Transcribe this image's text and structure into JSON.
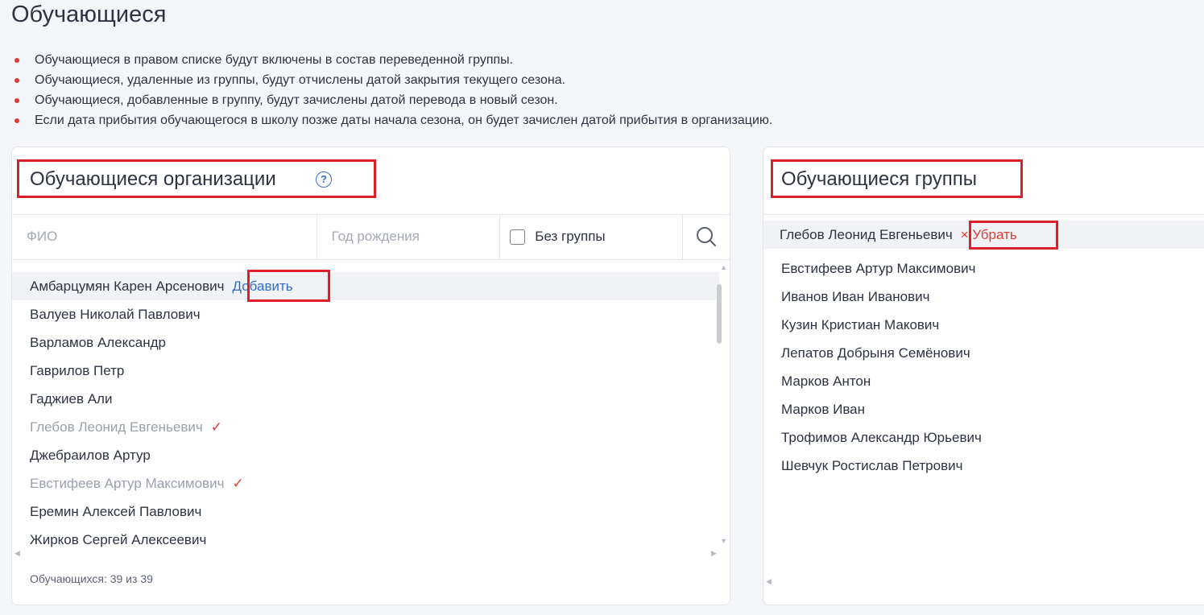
{
  "page": {
    "title": "Обучающиеся"
  },
  "notes": [
    "Обучающиеся в правом списке будут включены в состав переведенной группы.",
    "Обучающиеся, удаленные из группы, будут отчислены датой закрытия текущего сезона.",
    "Обучающиеся, добавленные в группу, будут зачислены датой перевода в новый сезон.",
    "Если дата прибытия обучающегося в школу позже даты начала сезона, он будет зачислен датой прибытия в организацию."
  ],
  "org_panel": {
    "title": "Обучающиеся организации",
    "help_icon": "?",
    "filters": {
      "fio_placeholder": "ФИО",
      "birth_year_placeholder": "Год рождения",
      "no_group_label": "Без группы"
    },
    "add_label": "Добавить",
    "students": [
      {
        "name": "Амбарцумян Карен Арсенович",
        "in_group": false,
        "hovered": true
      },
      {
        "name": "Валуев Николай Павлович",
        "in_group": false
      },
      {
        "name": "Варламов Александр",
        "in_group": false
      },
      {
        "name": "Гаврилов Петр",
        "in_group": false
      },
      {
        "name": "Гаджиев Али",
        "in_group": false
      },
      {
        "name": "Глебов Леонид Евгеньевич",
        "in_group": true
      },
      {
        "name": "Джебраилов Артур",
        "in_group": false
      },
      {
        "name": "Евстифеев Артур Максимович",
        "in_group": true
      },
      {
        "name": "Еремин Алексей Павлович",
        "in_group": false
      },
      {
        "name": "Жирков Сергей Алексеевич",
        "in_group": false
      }
    ],
    "count_text": "Обучающихся: 39 из 39"
  },
  "group_panel": {
    "title": "Обучающиеся группы",
    "remove_label": "× Убрать",
    "students": [
      {
        "name": "Глебов Леонид Евгеньевич",
        "hovered": true
      },
      {
        "name": "Евстифеев Артур Максимович"
      },
      {
        "name": "Иванов Иван Иванович"
      },
      {
        "name": "Кузин Кристиан Макович"
      },
      {
        "name": "Лепатов Добрыня Семёнович"
      },
      {
        "name": "Марков Антон"
      },
      {
        "name": "Марков Иван"
      },
      {
        "name": "Трофимов Александр Юрьевич"
      },
      {
        "name": "Шевчук Ростислав Петрович"
      }
    ]
  },
  "colors": {
    "accent_blue": "#2f6fd0",
    "accent_red": "#e53935",
    "highlight_red": "#e01e2a"
  }
}
